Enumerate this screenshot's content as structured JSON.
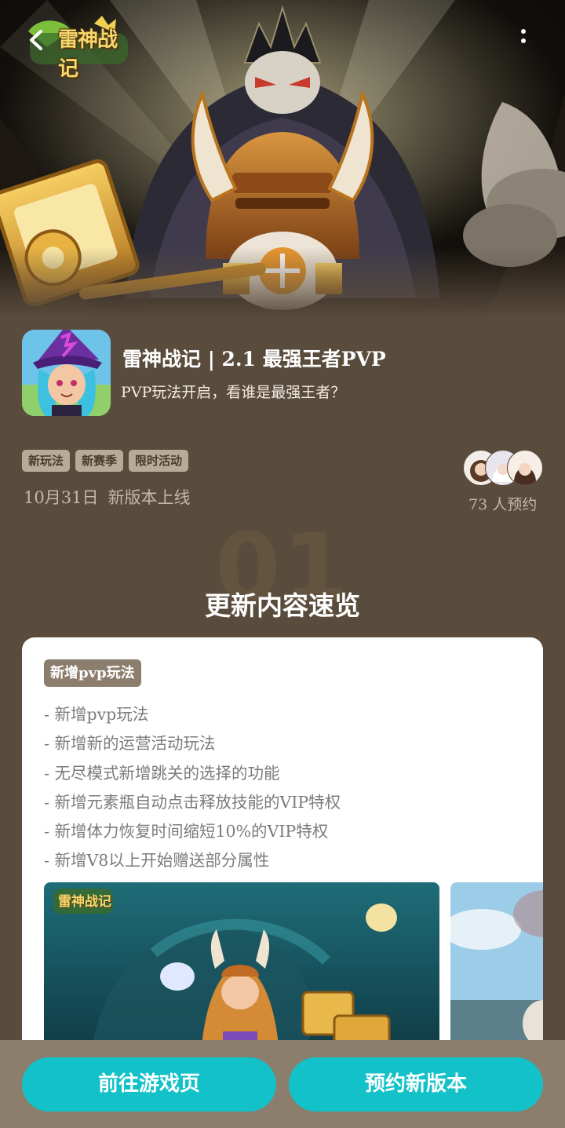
{
  "header": {
    "logo_text": "雷神战记",
    "back_icon": "back-arrow-icon",
    "more_icon": "more-vertical-icon"
  },
  "game": {
    "title": "雷神战记 | 2.1 最强王者PVP",
    "subtitle": "PVP玩法开启，看谁是最强王者？",
    "tags": [
      "新玩法",
      "新赛季",
      "限时活动"
    ],
    "date": "10月31日",
    "date_status": "新版本上线",
    "reserve_count": "73 人预约"
  },
  "section": {
    "number_watermark": "01",
    "title": "更新内容速览",
    "card_tag": "新增pvp玩法",
    "features": [
      "新增pvp玩法",
      "新增新的运营活动玩法",
      "无尽模式新增跳关的选择的功能",
      "新增元素瓶自动点击释放技能的VIP特权",
      "新增体力恢复时间缩短10%的VIP特权",
      "新增V8以上开始赠送部分属性"
    ],
    "screenshot_logo": "雷神战记"
  },
  "bottom": {
    "goto_game": "前往游戏页",
    "reserve_new": "预约新版本"
  },
  "colors": {
    "background": "#5a4c3c",
    "tag_bg": "#b7aa99",
    "card_tag_bg": "#8c7e6d",
    "button": "#12c2c8",
    "bottom_bar": "#8c7e6d"
  }
}
